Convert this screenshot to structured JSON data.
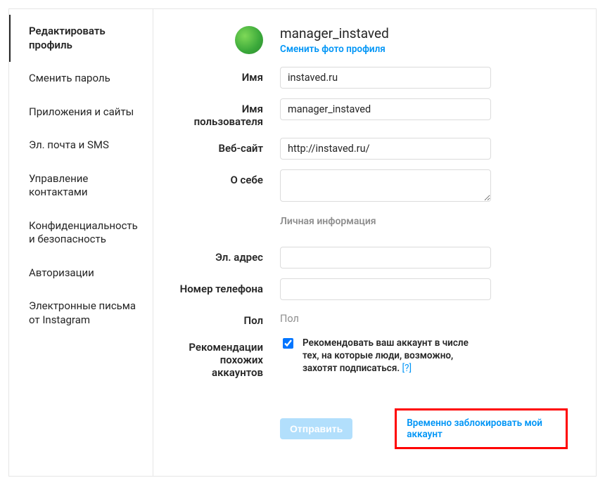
{
  "sidebar": {
    "items": [
      {
        "label": "Редактировать профиль",
        "active": true
      },
      {
        "label": "Сменить пароль",
        "active": false
      },
      {
        "label": "Приложения и сайты",
        "active": false
      },
      {
        "label": "Эл. почта и SMS",
        "active": false
      },
      {
        "label": "Управление контактами",
        "active": false
      },
      {
        "label": "Конфиденциальность и безопасность",
        "active": false
      },
      {
        "label": "Авторизации",
        "active": false
      },
      {
        "label": "Электронные письма от Instagram",
        "active": false
      }
    ]
  },
  "header": {
    "username": "manager_instaved",
    "change_photo": "Сменить фото профиля"
  },
  "fields": {
    "name_label": "Имя",
    "name_value": "instaved.ru",
    "username_label": "Имя пользователя",
    "username_value": "manager_instaved",
    "website_label": "Веб-сайт",
    "website_value": "http://instaved.ru/",
    "bio_label": "О себе",
    "bio_value": "",
    "private_info_title": "Личная информация",
    "email_label": "Эл. адрес",
    "email_value": "",
    "phone_label": "Номер телефона",
    "phone_value": "",
    "gender_label": "Пол",
    "gender_placeholder": "Пол",
    "similar_label": "Рекомендации похожих аккаунтов",
    "similar_text": "Рекомендовать ваш аккаунт в числе тех, на которые люди, возможно, захотят подписаться.",
    "similar_help": "[?]",
    "similar_checked": true
  },
  "actions": {
    "submit": "Отправить",
    "disable": "Временно заблокировать мой аккаунт"
  }
}
